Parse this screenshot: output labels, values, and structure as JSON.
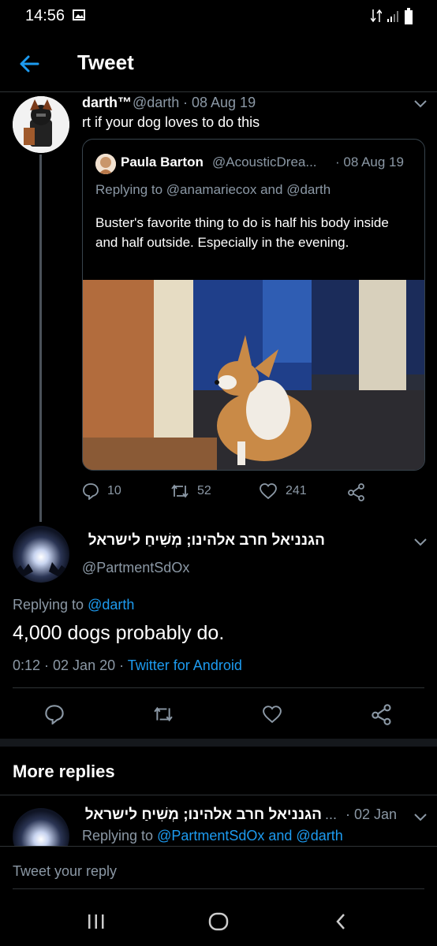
{
  "status_bar": {
    "time": "14:56"
  },
  "header": {
    "title": "Tweet"
  },
  "parent_tweet": {
    "author_name": "darth™",
    "handle": "@darth",
    "date": "· 08 Aug 19",
    "text": "rt if your dog loves to do this",
    "quoted": {
      "author_name": "Paula Barton",
      "handle": "@AcousticDrea...",
      "date": "· 08 Aug 19",
      "replying_prefix": "Replying to",
      "replying_to": "@anamariecox and @darth",
      "text": "Buster's favorite thing to do is half his body inside and half outside. Especially in the evening."
    },
    "stats": {
      "replies": "10",
      "retweets": "52",
      "likes": "241"
    }
  },
  "main_tweet": {
    "author_name": "הגנניאל חרב אלהינו; מְשִׁיחַ לישראל",
    "handle": "@PartmentSdOx",
    "replying_prefix": "Replying to",
    "replying_to": "@darth",
    "text": "4,000 dogs probably do.",
    "time": "0:12 · 02 Jan 20 ·",
    "source": "Twitter for Android"
  },
  "more_replies": {
    "heading": "More replies",
    "reply": {
      "author_name": "הגנניאל חרב אלהינו; מְשִׁיחַ לישראל",
      "ellipsis": "...",
      "date": "· 02 Jan",
      "replying_prefix": "Replying to",
      "replying_to": "@PartmentSdOx and @darth"
    }
  },
  "composer": {
    "placeholder": "Tweet your reply"
  },
  "colors": {
    "accent": "#1d9bf0",
    "muted": "#8b98a5",
    "background": "#000000"
  }
}
